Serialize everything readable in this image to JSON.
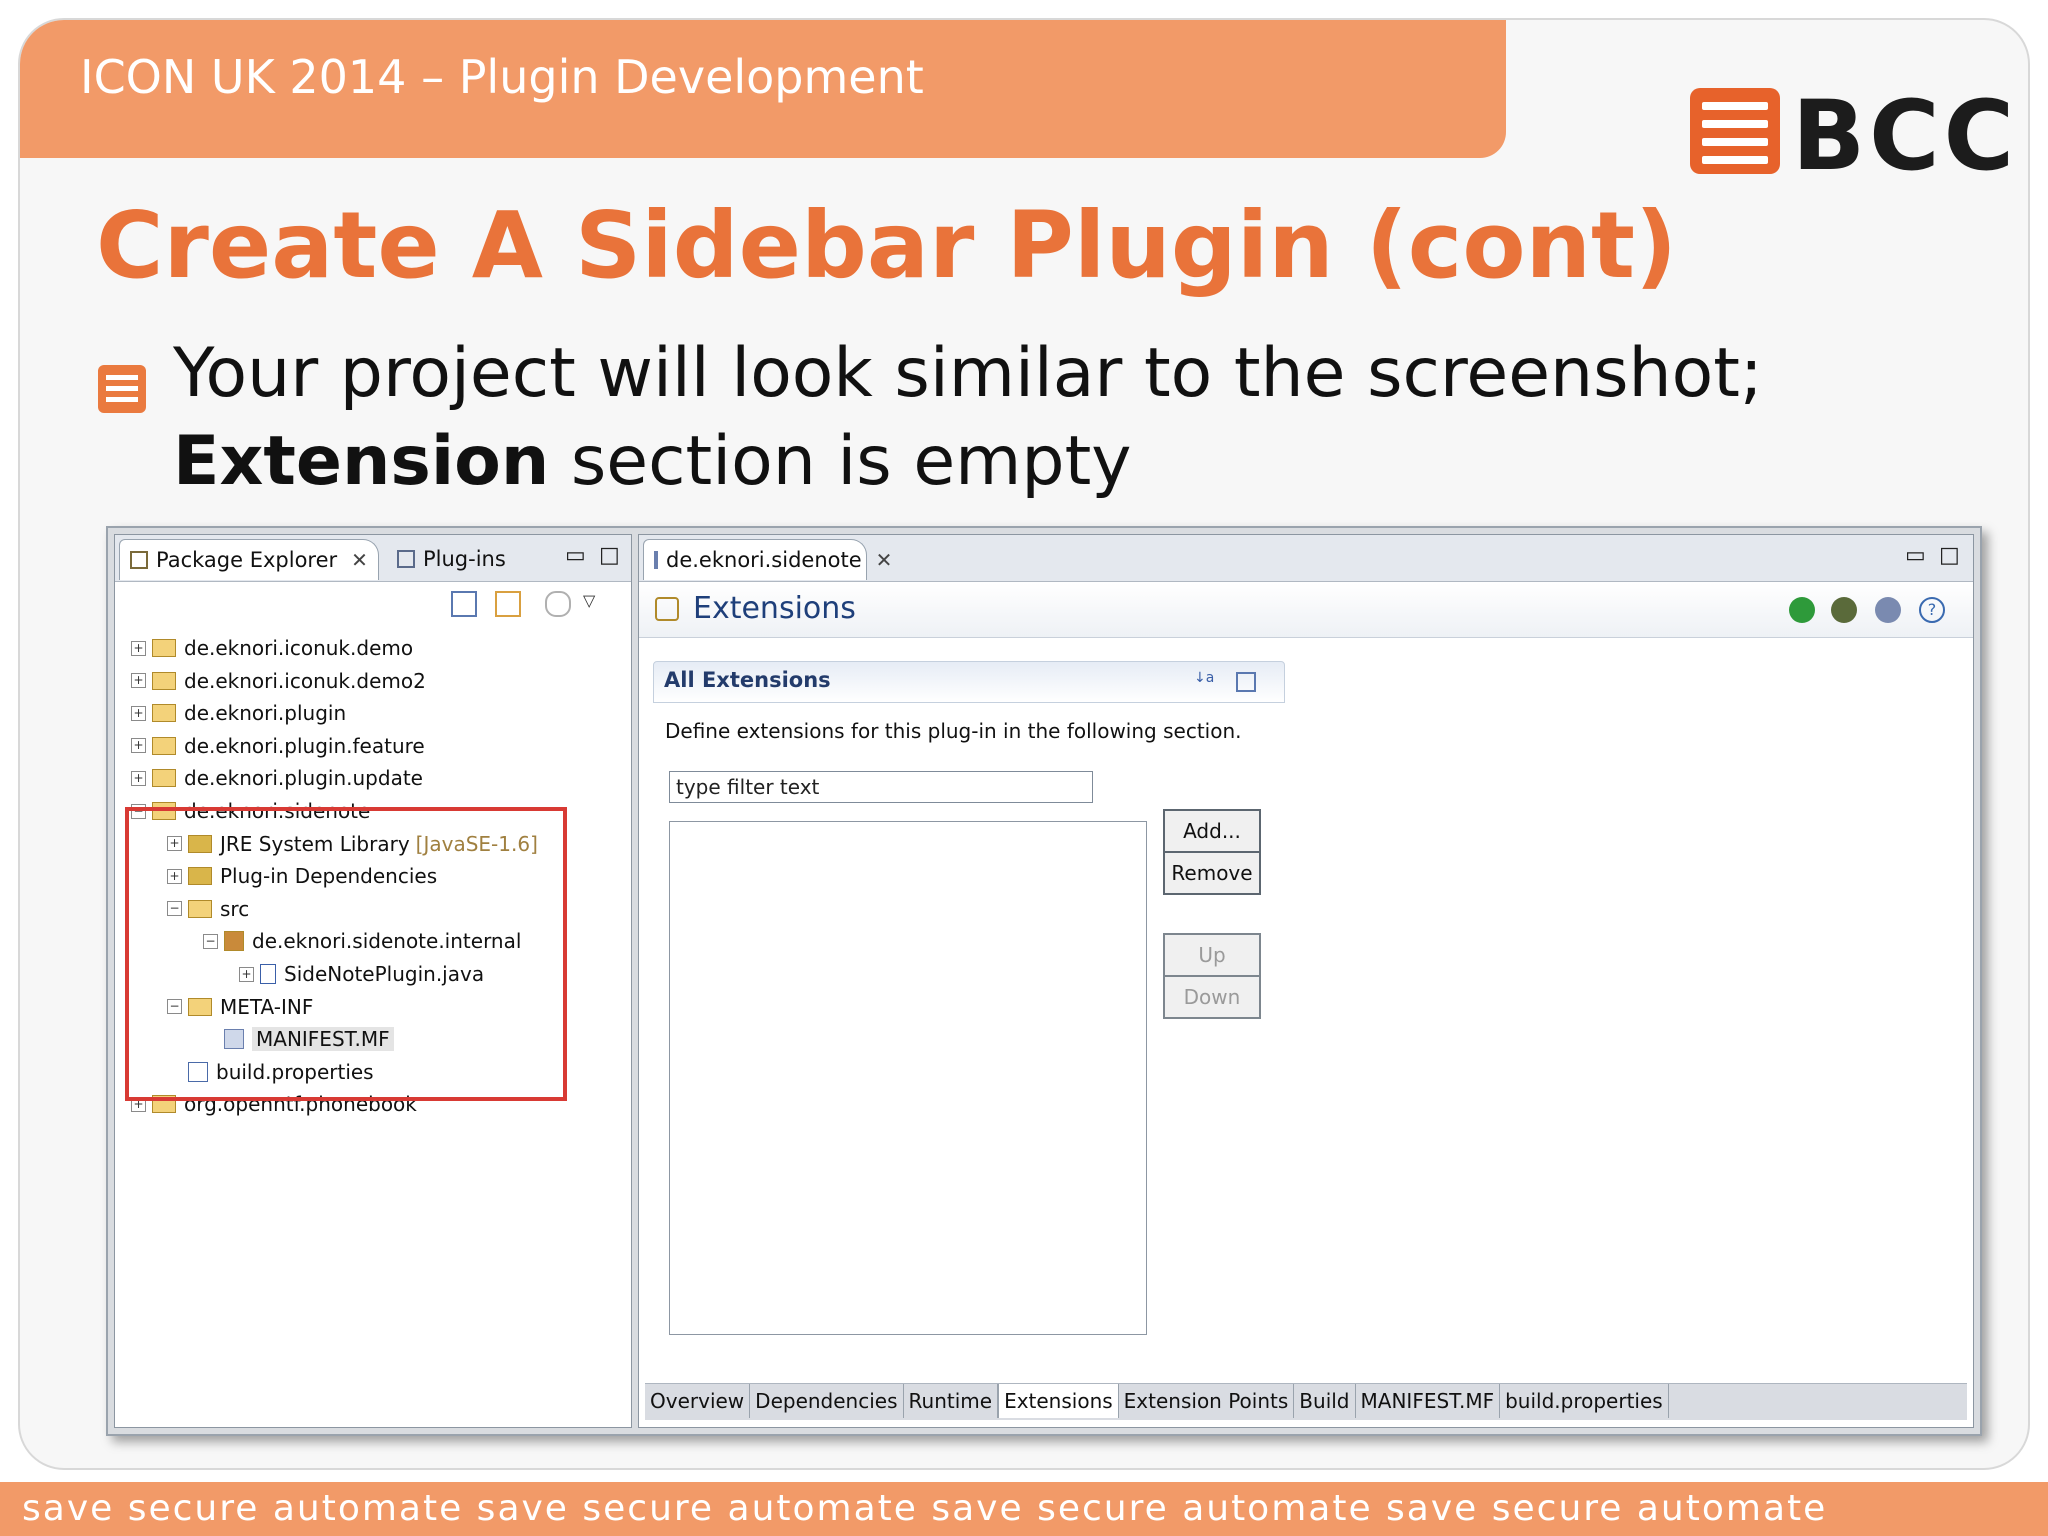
{
  "slide": {
    "header": "ICON UK  2014 – Plugin Development",
    "logo_text": "BCC",
    "title": "Create A Sidebar Plugin (cont)",
    "bullet_line1": "Your project will look similar to the screenshot;",
    "bullet_line2_bold": "Extension",
    "bullet_line2_rest": " section is empty",
    "footer": "save secure automate save secure automate save secure automate save secure automate"
  },
  "package_explorer": {
    "tab_label": "Package Explorer",
    "plugins_tab_label": "Plug-ins",
    "tree": [
      {
        "label": "de.eknori.iconuk.demo",
        "depth": 0,
        "expanded": false
      },
      {
        "label": "de.eknori.iconuk.demo2",
        "depth": 0,
        "expanded": false
      },
      {
        "label": "de.eknori.plugin",
        "depth": 0,
        "expanded": false
      },
      {
        "label": "de.eknori.plugin.feature",
        "depth": 0,
        "expanded": false
      },
      {
        "label": "de.eknori.plugin.update",
        "depth": 0,
        "expanded": false
      },
      {
        "label": "de.eknori.sidenote",
        "depth": 0,
        "expanded": true
      },
      {
        "label": "JRE System Library",
        "tag": "[JavaSE-1.6]",
        "depth": 1,
        "expanded": false
      },
      {
        "label": "Plug-in Dependencies",
        "depth": 1,
        "expanded": false
      },
      {
        "label": "src",
        "depth": 1,
        "expanded": true
      },
      {
        "label": "de.eknori.sidenote.internal",
        "depth": 2,
        "expanded": true
      },
      {
        "label": "SideNotePlugin.java",
        "depth": 3,
        "expanded": false
      },
      {
        "label": "META-INF",
        "depth": 1,
        "expanded": true
      },
      {
        "label": "MANIFEST.MF",
        "depth": 2,
        "selected": true
      },
      {
        "label": "build.properties",
        "depth": 1
      },
      {
        "label": "org.openntf.phonebook",
        "depth": 0,
        "expanded": false
      }
    ]
  },
  "editor": {
    "tab_label": "de.eknori.sidenote",
    "page_title": "Extensions",
    "section_title": "All Extensions",
    "description": "Define extensions for this plug-in in the following section.",
    "filter_value": "type filter text",
    "buttons": {
      "add": "Add...",
      "remove": "Remove",
      "up": "Up",
      "down": "Down"
    },
    "bottom_tabs": [
      "Overview",
      "Dependencies",
      "Runtime",
      "Extensions",
      "Extension Points",
      "Build",
      "MANIFEST.MF",
      "build.properties"
    ],
    "active_bottom_tab": "Extensions"
  },
  "colors": {
    "accent_orange": "#f29a68",
    "title_orange": "#e9733a",
    "highlight_red": "#d83a34"
  }
}
